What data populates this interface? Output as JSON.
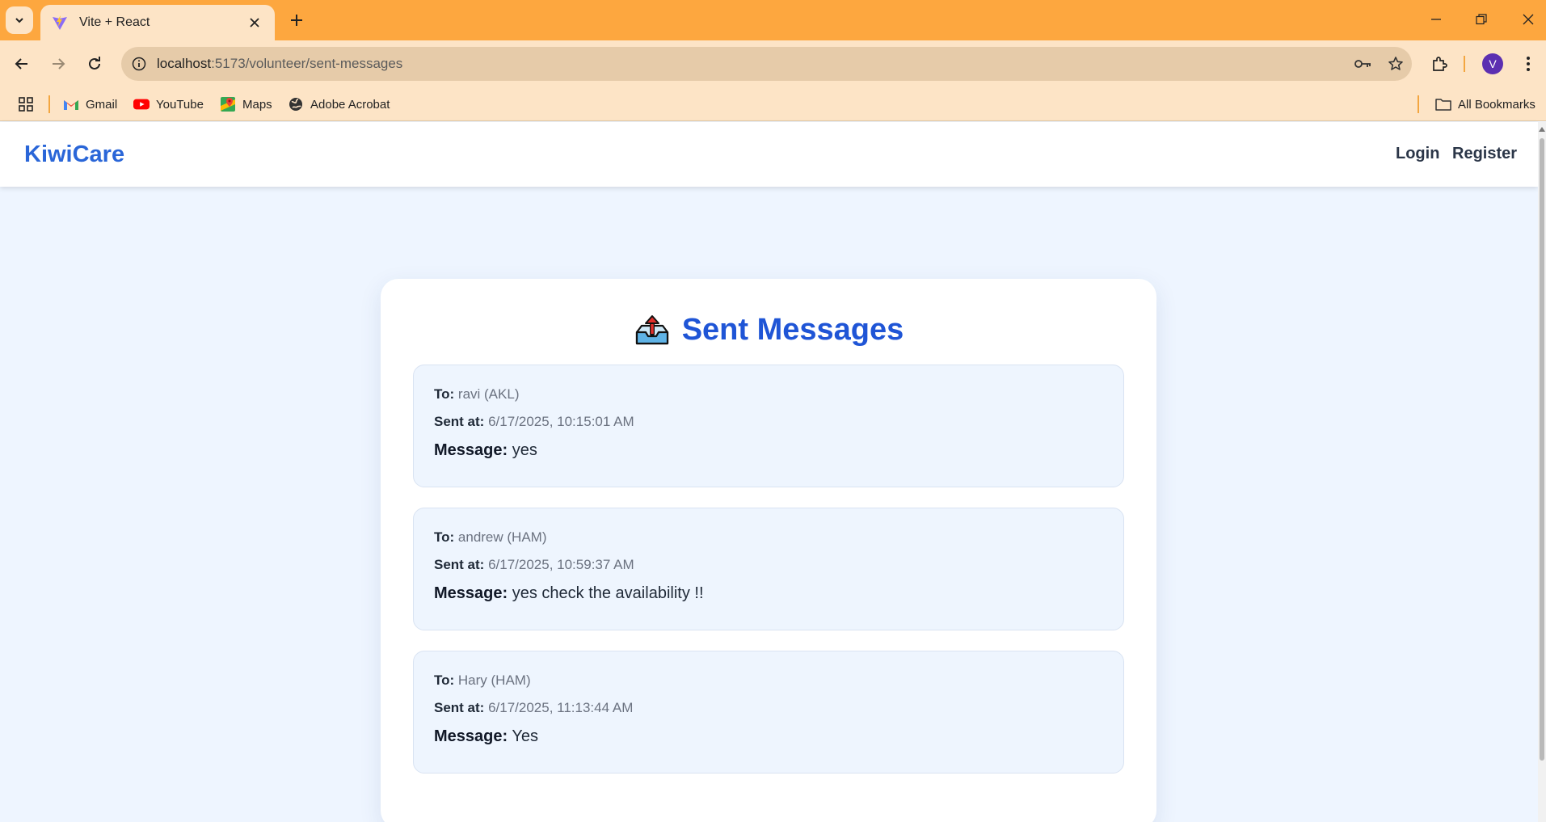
{
  "browser": {
    "tab_title": "Vite + React",
    "url_host": "localhost",
    "url_path": ":5173/volunteer/sent-messages",
    "profile_initial": "V",
    "bookmarks": [
      {
        "label": "Gmail",
        "icon": "gmail-icon"
      },
      {
        "label": "YouTube",
        "icon": "youtube-icon"
      },
      {
        "label": "Maps",
        "icon": "maps-icon"
      },
      {
        "label": "Adobe Acrobat",
        "icon": "globe-icon"
      }
    ],
    "all_bookmarks": "All Bookmarks"
  },
  "navbar": {
    "brand": "KiwiCare",
    "login": "Login",
    "register": "Register"
  },
  "card": {
    "title": "Sent Messages",
    "to_label": "To:",
    "sent_label": "Sent at:",
    "message_label": "Message:",
    "messages": [
      {
        "to": "ravi (AKL)",
        "sent_at": "6/17/2025, 10:15:01 AM",
        "message": "yes"
      },
      {
        "to": "andrew (HAM)",
        "sent_at": "6/17/2025, 10:59:37 AM",
        "message": "yes check the availability !!"
      },
      {
        "to": "Hary (HAM)",
        "sent_at": "6/17/2025, 11:13:44 AM",
        "message": "Yes"
      }
    ]
  },
  "colors": {
    "tabstrip": "#fda73f",
    "toolbar": "#fde4c6",
    "brand": "#2a66d8",
    "page_bg": "#eef5ff",
    "title": "#1f55d6"
  }
}
